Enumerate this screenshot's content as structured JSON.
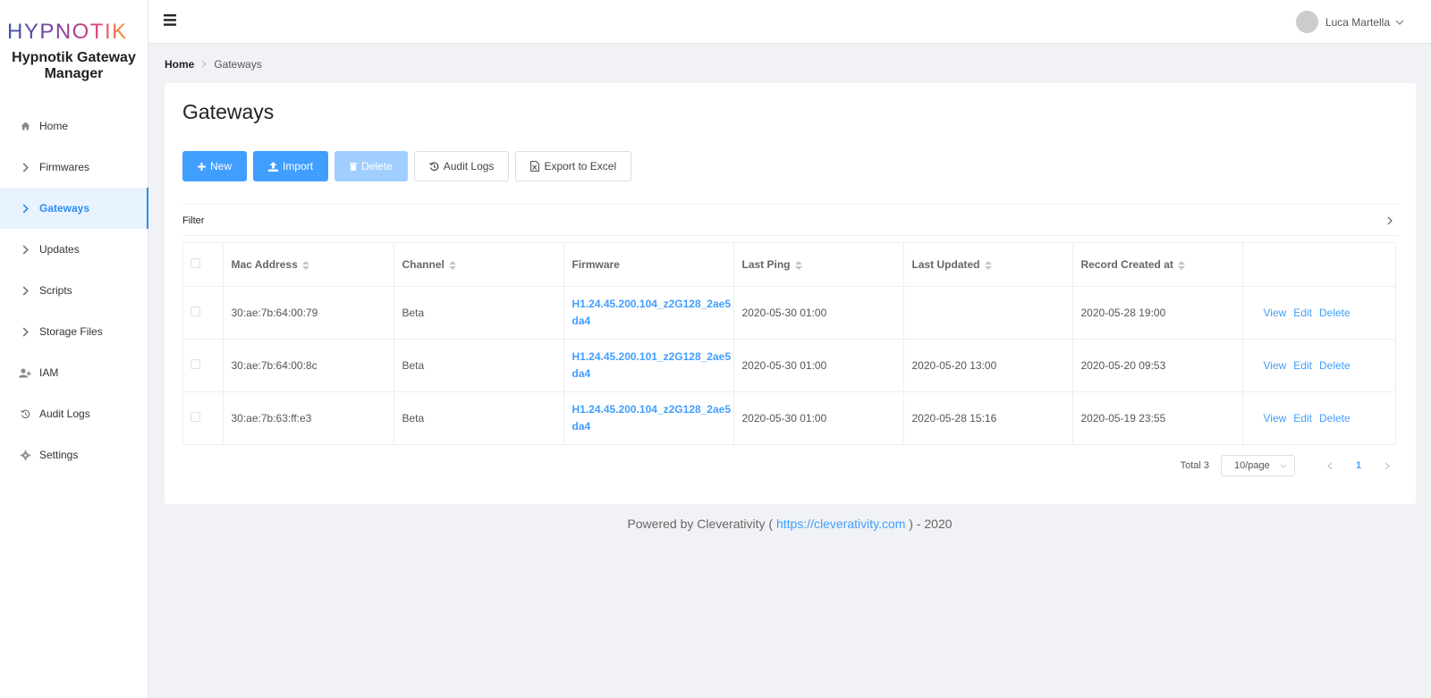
{
  "brand": {
    "logo_text": "HYPNOTIK",
    "app_title": "Hypnotik Gateway Manager"
  },
  "sidebar": {
    "items": [
      {
        "label": "Home",
        "icon": "home-icon"
      },
      {
        "label": "Firmwares",
        "icon": "chevron-right-icon"
      },
      {
        "label": "Gateways",
        "icon": "chevron-right-icon",
        "active": true
      },
      {
        "label": "Updates",
        "icon": "chevron-right-icon"
      },
      {
        "label": "Scripts",
        "icon": "chevron-right-icon"
      },
      {
        "label": "Storage Files",
        "icon": "chevron-right-icon"
      },
      {
        "label": "IAM",
        "icon": "user-add-icon"
      },
      {
        "label": "Audit Logs",
        "icon": "history-icon"
      },
      {
        "label": "Settings",
        "icon": "gear-icon"
      }
    ]
  },
  "header": {
    "user_name": "Luca Martella"
  },
  "breadcrumb": {
    "home": "Home",
    "current": "Gateways"
  },
  "page": {
    "title": "Gateways"
  },
  "toolbar": {
    "new_label": "New",
    "import_label": "Import",
    "delete_label": "Delete",
    "audit_label": "Audit Logs",
    "export_label": "Export to Excel"
  },
  "filter": {
    "label": "Filter"
  },
  "table": {
    "columns": [
      "Mac Address",
      "Channel",
      "Firmware",
      "Last Ping",
      "Last Updated",
      "Record Created at"
    ],
    "rows": [
      {
        "mac": "30:ae:7b:64:00:79",
        "channel": "Beta",
        "firmware": "H1.24.45.200.104_z2G128_2ae5da4",
        "last_ping": "2020-05-30 01:00",
        "last_updated": "",
        "created": "2020-05-28 19:00"
      },
      {
        "mac": "30:ae:7b:64:00:8c",
        "channel": "Beta",
        "firmware": "H1.24.45.200.101_z2G128_2ae5da4",
        "last_ping": "2020-05-30 01:00",
        "last_updated": "2020-05-20 13:00",
        "created": "2020-05-20 09:53"
      },
      {
        "mac": "30:ae:7b:63:ff:e3",
        "channel": "Beta",
        "firmware": "H1.24.45.200.104_z2G128_2ae5da4",
        "last_ping": "2020-05-30 01:00",
        "last_updated": "2020-05-28 15:16",
        "created": "2020-05-19 23:55"
      }
    ],
    "actions": {
      "view": "View",
      "edit": "Edit",
      "delete": "Delete"
    }
  },
  "pagination": {
    "total": "Total 3",
    "page_size": "10/page",
    "current_page": "1"
  },
  "footer": {
    "prefix": "Powered by Cleverativity (",
    "link": "https://cleverativity.com",
    "suffix": ") - 2020"
  },
  "colors": {
    "primary": "#409eff",
    "primary_disabled": "#a0cfff",
    "active_bg": "#e8f3ff",
    "page_bg": "#f0f2f5"
  }
}
